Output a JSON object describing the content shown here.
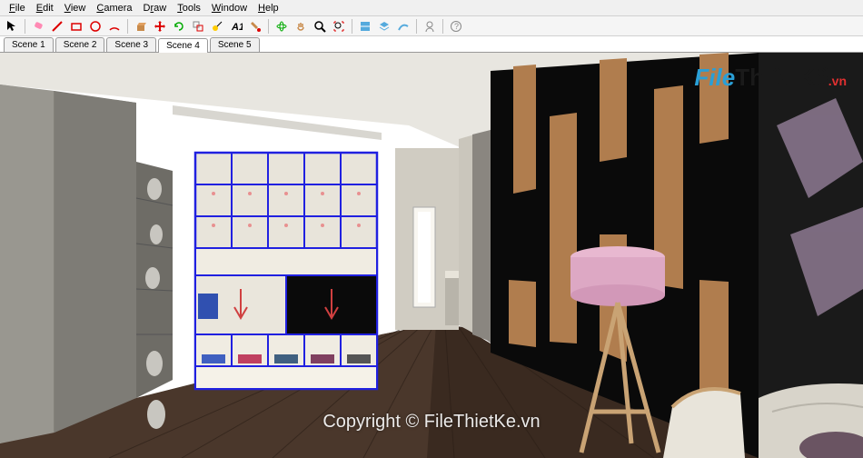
{
  "menu": {
    "file": "File",
    "edit": "Edit",
    "view": "View",
    "camera": "Camera",
    "draw": "Draw",
    "tools": "Tools",
    "window": "Window",
    "help": "Help"
  },
  "toolbar": {
    "icons": [
      "select-arrow",
      "eraser",
      "line",
      "rectangle",
      "circle",
      "arc",
      "pushpull",
      "move",
      "rotate",
      "scale",
      "offset",
      "tape",
      "text",
      "paint",
      "orbit",
      "pan",
      "zoom",
      "zoom-extents",
      "section",
      "plugin1",
      "plugin2",
      "plugin3",
      "plugin4",
      "profile"
    ]
  },
  "scenes": {
    "tabs": [
      {
        "label": "Scene 1",
        "active": false
      },
      {
        "label": "Scene 2",
        "active": false
      },
      {
        "label": "Scene 3",
        "active": false
      },
      {
        "label": "Scene 4",
        "active": true
      },
      {
        "label": "Scene 5",
        "active": false
      }
    ]
  },
  "watermark": {
    "logo_part1": "File",
    "logo_part2": "Thiết Kế",
    "logo_part3": ".vn",
    "copyright": "Copyright © FileThietKe.vn"
  }
}
